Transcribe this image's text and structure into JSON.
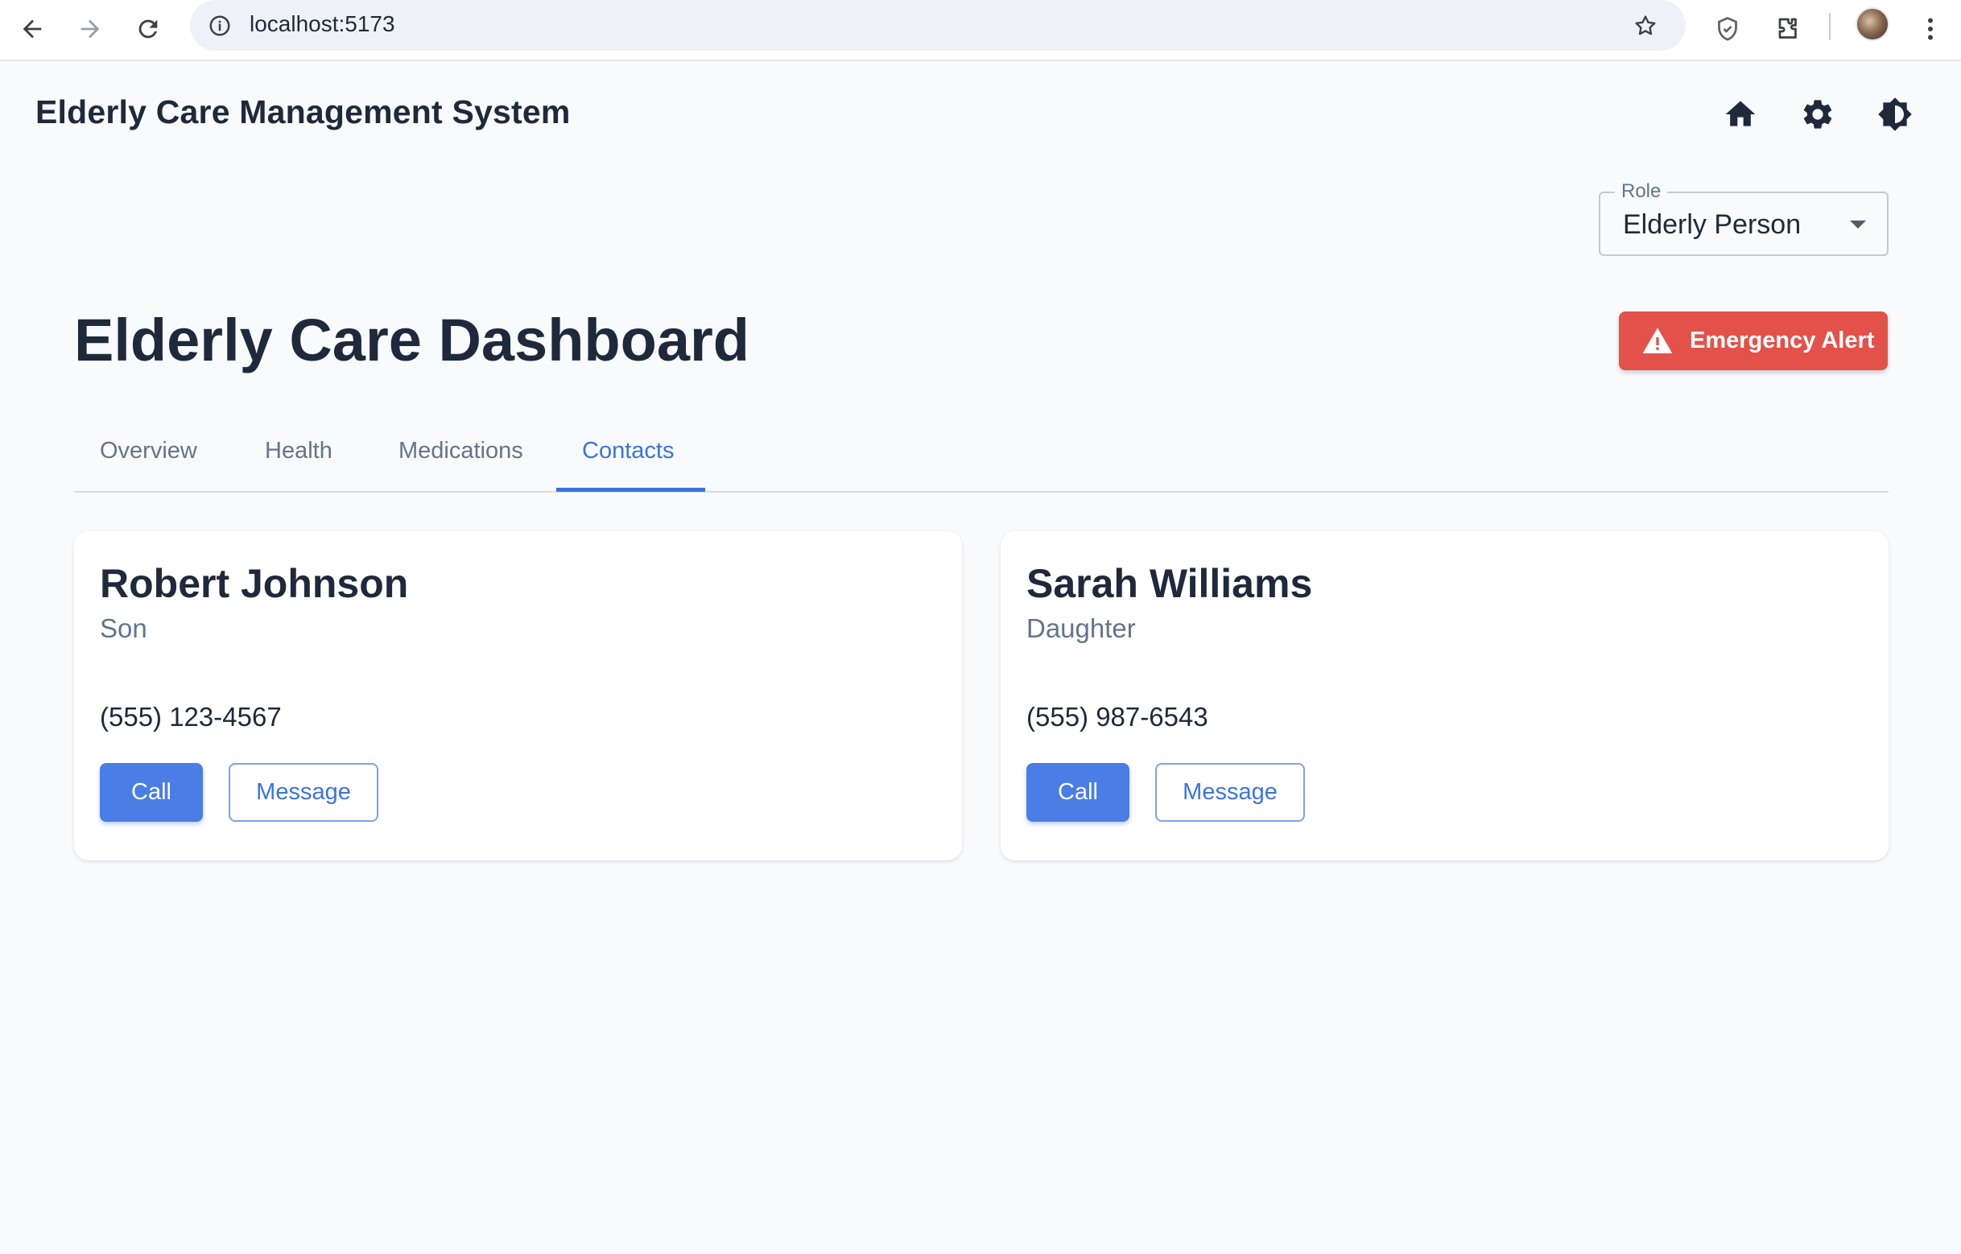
{
  "browser": {
    "url": "localhost:5173",
    "icons": [
      "back-arrow-icon",
      "forward-arrow-icon",
      "reload-icon",
      "info-icon",
      "star-icon",
      "shield-icon",
      "puzzle-icon",
      "profile-avatar",
      "kebab-menu-icon"
    ]
  },
  "header": {
    "app_title": "Elderly Care Management System",
    "icons": [
      "home-icon",
      "gear-icon",
      "brightness-icon"
    ]
  },
  "role_select": {
    "label": "Role",
    "value": "Elderly Person"
  },
  "dashboard": {
    "title": "Elderly Care Dashboard",
    "emergency_label": "Emergency Alert",
    "emergency_color": "#e2524a"
  },
  "tabs": [
    {
      "label": "Overview",
      "active": false
    },
    {
      "label": "Health",
      "active": false
    },
    {
      "label": "Medications",
      "active": false
    },
    {
      "label": "Contacts",
      "active": true
    }
  ],
  "contacts": [
    {
      "name": "Robert Johnson",
      "relation": "Son",
      "phone": "(555) 123-4567",
      "call_label": "Call",
      "message_label": "Message"
    },
    {
      "name": "Sarah Williams",
      "relation": "Daughter",
      "phone": "(555) 987-6543",
      "call_label": "Call",
      "message_label": "Message"
    }
  ],
  "theme": {
    "accent": "#3b73de",
    "primary_button": "#4a7de6",
    "background": "#f8fafc",
    "text": "#1e293b"
  }
}
